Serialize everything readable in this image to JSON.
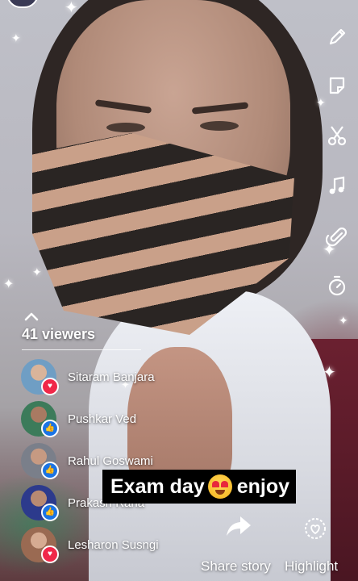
{
  "story": {
    "caption_before": "Exam day",
    "caption_after": "enjoy",
    "caption_emoji": "heart-eyes-emoji"
  },
  "viewers": {
    "count_label": "41 viewers",
    "list": [
      {
        "name": "Sitaram Banjara",
        "reaction": "love",
        "avatar_color": "#6f9ec4"
      },
      {
        "name": "Pushkar Ved",
        "reaction": "like",
        "avatar_color": "#3c7b5a"
      },
      {
        "name": "Rahul Goswami",
        "reaction": "like",
        "avatar_color": "#7a7f8a"
      },
      {
        "name": "Prakash Rana",
        "reaction": "like",
        "avatar_color": "#2c3a8c"
      },
      {
        "name": "Lesharon Susngi",
        "reaction": "love",
        "avatar_color": "#9a6a52"
      }
    ]
  },
  "toolbar": {
    "icons": [
      "pencil-icon",
      "sticker-icon",
      "scissors-icon",
      "music-note-icon",
      "paperclip-icon",
      "timer-icon"
    ]
  },
  "actions": {
    "share_label": "Share story",
    "highlight_label": "Highlight"
  },
  "colors": {
    "love": "#f02849",
    "like": "#1b74e4",
    "caption_bg": "#000000"
  }
}
